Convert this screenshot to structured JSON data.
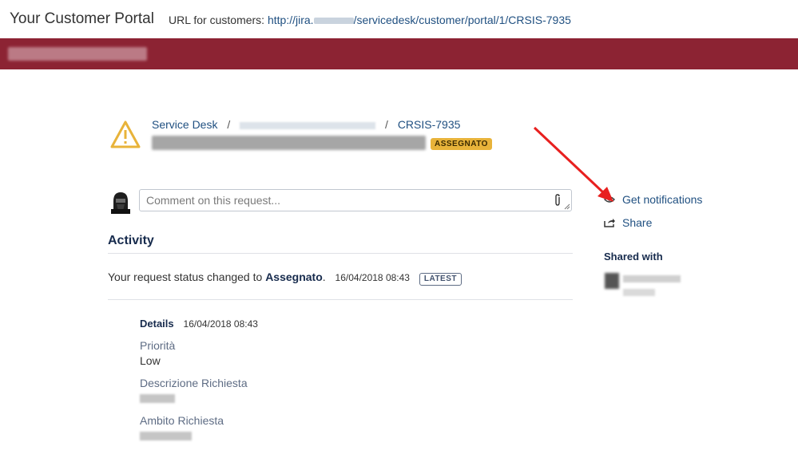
{
  "header": {
    "title": "Your Customer Portal",
    "url_label": "URL for customers:",
    "url_prefix": "http://jira.",
    "url_suffix": "/servicedesk/customer/portal/1/CRSIS-7935"
  },
  "breadcrumb": {
    "root": "Service Desk",
    "separator": "/",
    "issue_key": "CRSIS-7935"
  },
  "request": {
    "status": "ASSEGNATO"
  },
  "comment": {
    "placeholder": "Comment on this request..."
  },
  "activity": {
    "heading": "Activity",
    "status_prefix": "Your request status changed to",
    "status_value": "Assegnato",
    "status_suffix": ".",
    "timestamp": "16/04/2018 08:43",
    "latest_badge": "LATEST"
  },
  "details": {
    "label": "Details",
    "timestamp": "16/04/2018 08:43",
    "fields": [
      {
        "label": "Priorità",
        "value": "Low"
      },
      {
        "label": "Descrizione Richiesta",
        "value": ""
      },
      {
        "label": "Ambito Richiesta",
        "value": ""
      }
    ]
  },
  "sidebar": {
    "notifications": "Get notifications",
    "share": "Share",
    "shared_with": "Shared with"
  },
  "colors": {
    "banner": "#8c2333",
    "link": "#205081",
    "status_lozenge": "#e8b33a",
    "annotation_arrow": "#e8201f"
  },
  "icons": [
    "warning-icon",
    "paperclip-icon",
    "eye-icon",
    "share-icon"
  ]
}
